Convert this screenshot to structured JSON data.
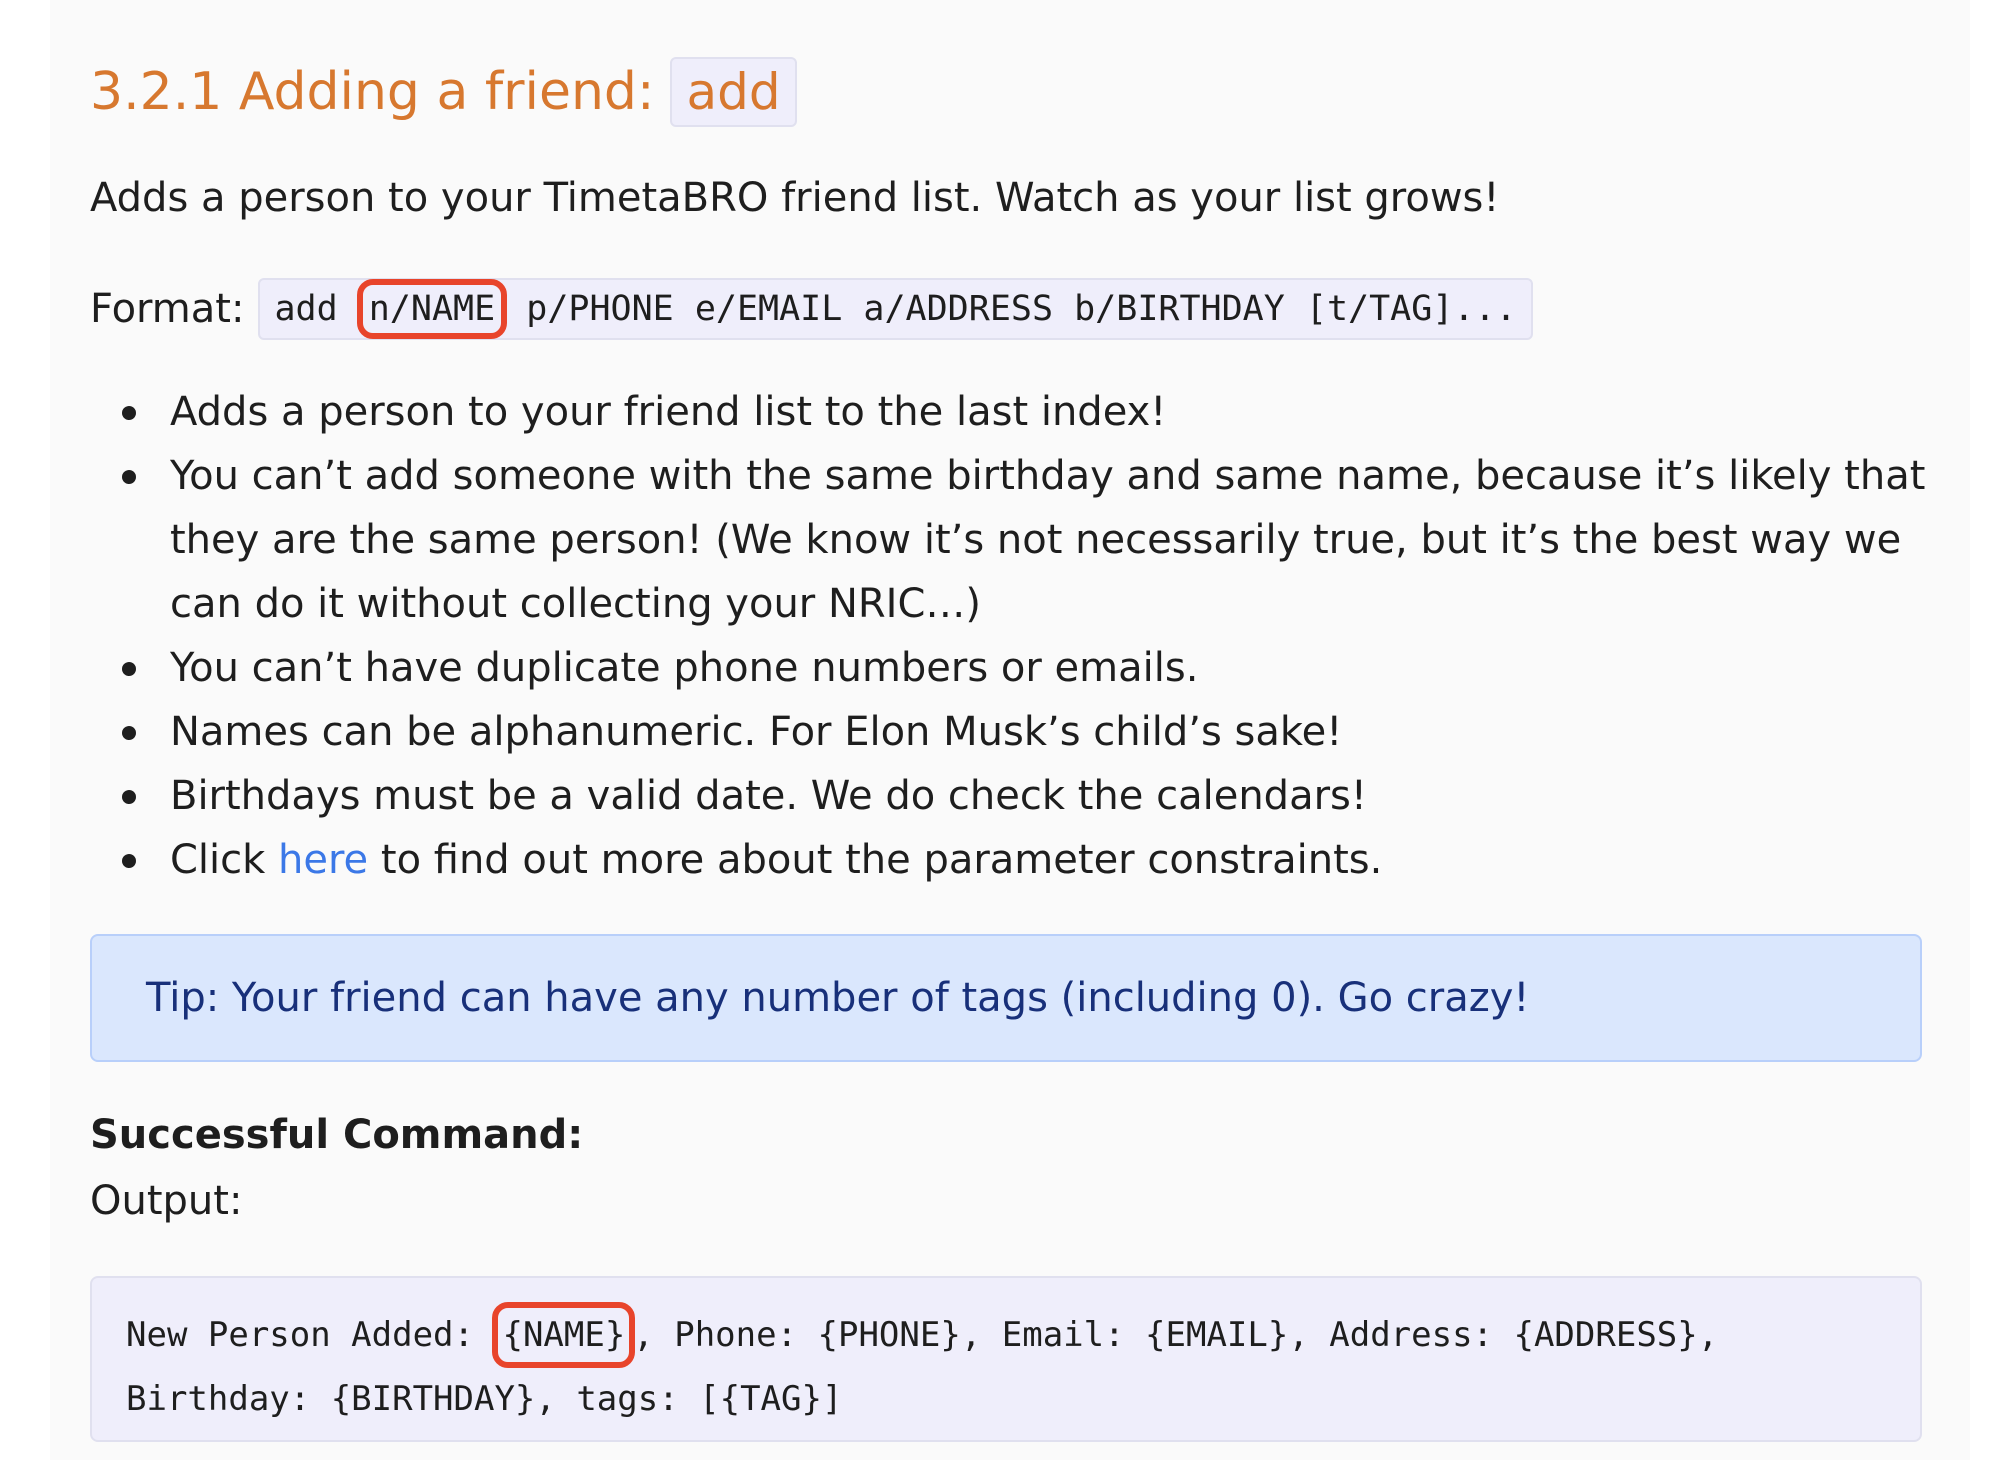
{
  "section": {
    "heading_text": "3.2.1 Adding a friend:",
    "heading_code": "add",
    "intro": "Adds a person to your TimetaBRO friend list. Watch as your list grows!",
    "format_label": "Format:",
    "format_code": {
      "prefix": "add ",
      "highlighted": "n/NAME",
      "suffix": " p/PHONE e/EMAIL a/ADDRESS b/BIRTHDAY [t/TAG]..."
    },
    "bullets": [
      "Adds a person to your friend list to the last index!",
      "You can’t add someone with the same birthday and same name, because it’s likely that they are the same person! (We know it’s not necessarily true, but it’s the best way we can do it without collecting your NRIC…)",
      "You can’t have duplicate phone numbers or emails.",
      "Names can be alphanumeric. For Elon Musk’s child’s sake!",
      "Birthdays must be a valid date. We do check the calendars!"
    ],
    "last_bullet": {
      "before": "Click ",
      "link": "here",
      "after": " to find out more about the parameter constraints."
    },
    "tip": "Tip: Your friend can have any number of tags (including 0). Go crazy!",
    "success_label": "Successful Command:",
    "output_label": "Output:",
    "output": {
      "line1_prefix": "New Person Added: ",
      "line1_highlighted": "{NAME}",
      "line1_suffix": ", Phone: {PHONE}, Email: {EMAIL}, Address: {ADDRESS},",
      "line2": "Birthday: {BIRTHDAY}, tags: [{TAG}]"
    }
  },
  "colors": {
    "heading": "#d7782f",
    "highlight_border": "#e8442b",
    "link": "#3b78e7",
    "tip_background": "#dae7fd",
    "tip_text": "#18307a",
    "code_background": "#efeefb"
  }
}
